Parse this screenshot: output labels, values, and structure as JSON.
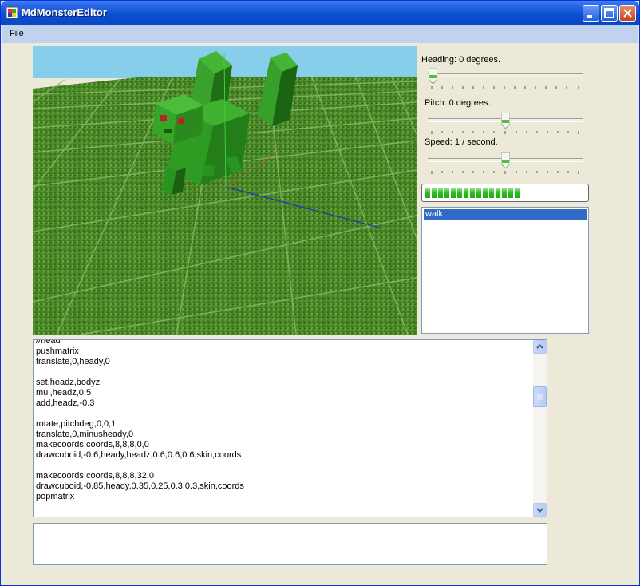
{
  "window": {
    "title": "MdMonsterEditor"
  },
  "menu": {
    "items": [
      {
        "label": "File"
      }
    ]
  },
  "controls": {
    "heading": {
      "label": "Heading: 0 degrees.",
      "value_fraction": 0.0
    },
    "pitch": {
      "label": "Pitch: 0 degrees.",
      "value_fraction": 0.5
    },
    "speed": {
      "label": "Speed: 1 / second.",
      "value_fraction": 0.5
    },
    "progress": {
      "segments": 15,
      "value_fraction": 0.63
    }
  },
  "animations": {
    "items": [
      {
        "label": "walk",
        "selected": true
      }
    ]
  },
  "script_editor": {
    "lines": [
      "//head",
      "pushmatrix",
      "translate,0,heady,0",
      "",
      "set,headz,bodyz",
      "mul,headz,0.5",
      "add,headz,-0.3",
      "",
      "rotate,pitchdeg,0,0,1",
      "translate,0,minusheady,0",
      "makecoords,coords,8,8,8,0,0",
      "drawcuboid,-0.6,heady,headz,0.6,0.6,0.6,skin,coords",
      "",
      "makecoords,coords,8,8,8,32,0",
      "drawcuboid,-0.85,heady,0.35,0.25,0.3,0.3,skin,coords",
      "popmatrix"
    ]
  },
  "command_input": {
    "value": ""
  },
  "colors": {
    "sky": "#87ceeb",
    "grass": "#4c8a2a",
    "monster": "#2a9a1c",
    "selection": "#316ac5"
  }
}
